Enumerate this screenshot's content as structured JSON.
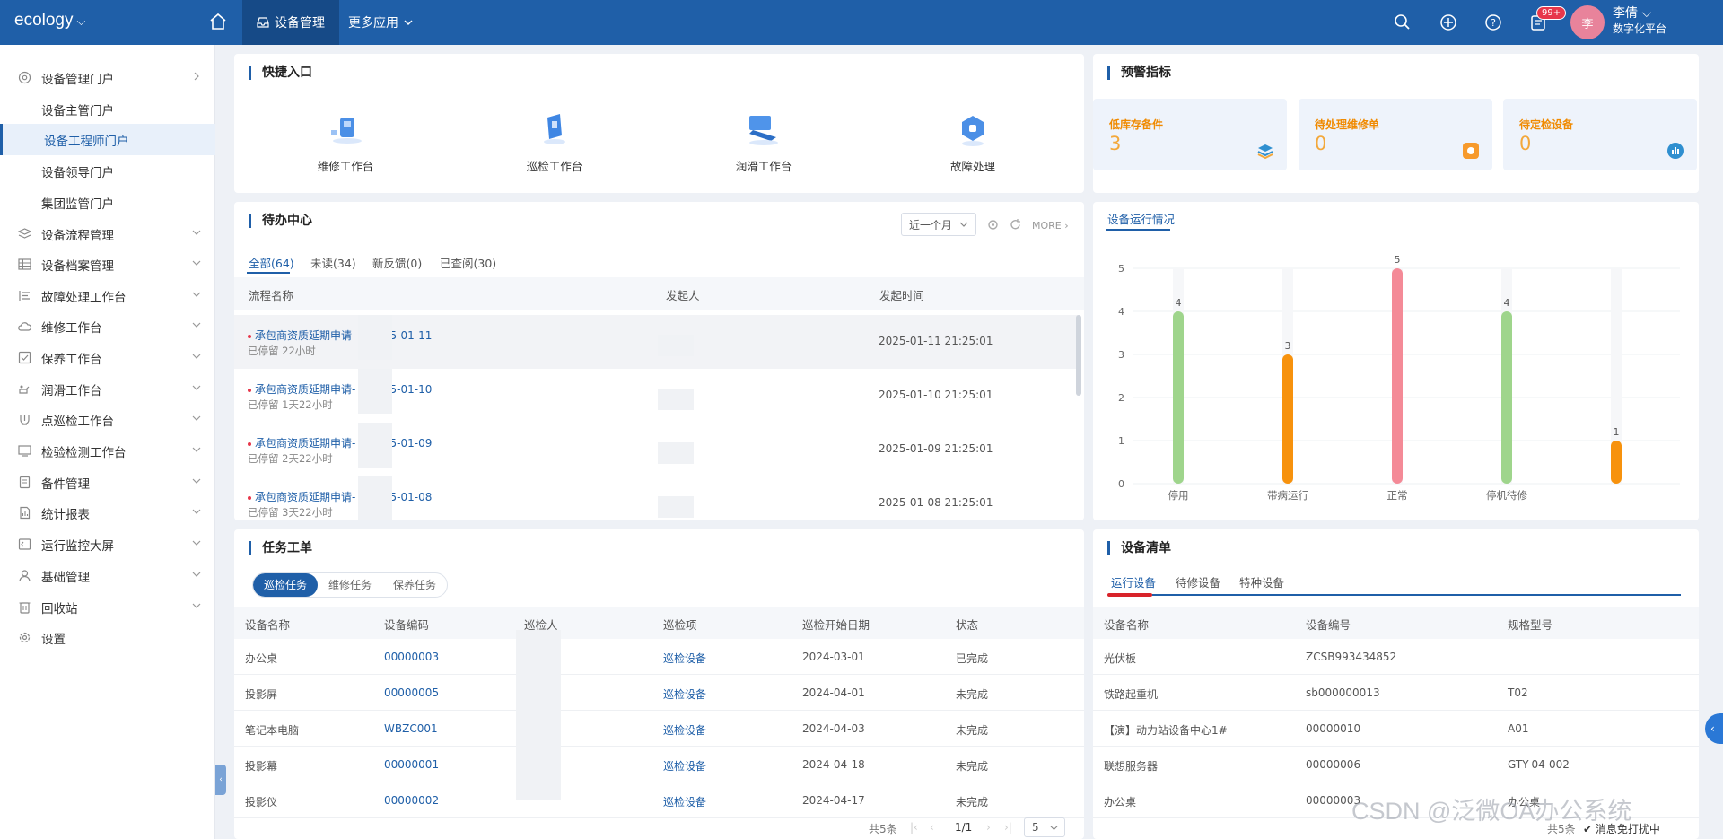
{
  "topbar": {
    "brand": "ecology",
    "nav_active": "设备管理",
    "nav_more": "更多应用",
    "badge": "99+",
    "avatar_text": "李",
    "user_name": "李倩",
    "user_org": "数字化平台"
  },
  "sidebar": {
    "items": [
      {
        "label": "设备管理门户",
        "icon": "at-icon"
      },
      {
        "label": "设备主管门户",
        "icon": ""
      },
      {
        "label": "设备工程师门户",
        "icon": ""
      },
      {
        "label": "设备领导门户",
        "icon": ""
      },
      {
        "label": "集团监管门户",
        "icon": ""
      },
      {
        "label": "设备流程管理",
        "icon": "layers-icon"
      },
      {
        "label": "设备档案管理",
        "icon": "table-icon"
      },
      {
        "label": "故障处理工作台",
        "icon": "list-icon"
      },
      {
        "label": "维修工作台",
        "icon": "cloud-icon"
      },
      {
        "label": "保养工作台",
        "icon": "check-icon"
      },
      {
        "label": "润滑工作台",
        "icon": "oil-icon"
      },
      {
        "label": "点巡检工作台",
        "icon": "tools-icon"
      },
      {
        "label": "检验检测工作台",
        "icon": "monitor-icon"
      },
      {
        "label": "备件管理",
        "icon": "doc-icon"
      },
      {
        "label": "统计报表",
        "icon": "report-icon"
      },
      {
        "label": "运行监控大屏",
        "icon": "screen-icon"
      },
      {
        "label": "基础管理",
        "icon": "user-icon"
      },
      {
        "label": "回收站",
        "icon": "trash-icon"
      },
      {
        "label": "设置",
        "icon": "gear-icon"
      }
    ]
  },
  "quick": {
    "title": "快捷入口",
    "items": [
      "维修工作台",
      "巡检工作台",
      "润滑工作台",
      "故障处理"
    ]
  },
  "warning": {
    "title": "预警指标",
    "items": [
      {
        "label": "低库存备件",
        "value": "3"
      },
      {
        "label": "待处理维修单",
        "value": "0"
      },
      {
        "label": "待定检设备",
        "value": "0"
      }
    ]
  },
  "todo": {
    "title": "待办中心",
    "period": "近一个月",
    "more": "MORE",
    "tabs": [
      "全部(64)",
      "未读(34)",
      "新反馈(0)",
      "已查阅(30)"
    ],
    "headers": [
      "流程名称",
      "发起人",
      "发起时间"
    ],
    "rows": [
      {
        "name_a": "承包商资质延期申请-",
        "name_b": "025-01-11",
        "status": "已停留  22小时",
        "time": "2025-01-11 21:25:01"
      },
      {
        "name_a": "承包商资质延期申请-",
        "name_b": "025-01-10",
        "status": "已停留  1天22小时",
        "time": "2025-01-10 21:25:01"
      },
      {
        "name_a": "承包商资质延期申请-",
        "name_b": "025-01-09",
        "status": "已停留  2天22小时",
        "time": "2025-01-09 21:25:01"
      },
      {
        "name_a": "承包商资质延期申请-",
        "name_b": "025-01-08",
        "status": "已停留  3天22小时",
        "time": "2025-01-08 21:25:01"
      }
    ]
  },
  "chart_panel": {
    "tab": "设备运行情况"
  },
  "chart_data": {
    "type": "bar",
    "categories": [
      "停用",
      "带病运行",
      "正常",
      "停机待修",
      ""
    ],
    "values": [
      4,
      3,
      5,
      4,
      1
    ],
    "colors": [
      "#9fd58c",
      "#f7920d",
      "#f48a97",
      "#9fd58c",
      "#f7920d"
    ],
    "yticks": [
      "0",
      "1",
      "2",
      "3",
      "4",
      "5"
    ],
    "ylim": [
      0,
      5
    ],
    "grid": true
  },
  "tasks": {
    "title": "任务工单",
    "tabs": [
      "巡检任务",
      "维修任务",
      "保养任务"
    ],
    "headers": [
      "设备名称",
      "设备编码",
      "巡检人",
      "巡检项",
      "巡检开始日期",
      "状态"
    ],
    "rows": [
      {
        "name": "办公桌",
        "code": "00000003",
        "item": "巡检设备",
        "date": "2024-03-01",
        "status": "已完成"
      },
      {
        "name": "投影屏",
        "code": "00000005",
        "item": "巡检设备",
        "date": "2024-04-01",
        "status": "未完成"
      },
      {
        "name": "笔记本电脑",
        "code": "WBZC001",
        "item": "巡检设备",
        "date": "2024-04-03",
        "status": "未完成"
      },
      {
        "name": "投影幕",
        "code": "00000001",
        "item": "巡检设备",
        "date": "2024-04-18",
        "status": "未完成"
      },
      {
        "name": "投影仪",
        "code": "00000002",
        "item": "巡检设备",
        "date": "2024-04-17",
        "status": "未完成"
      }
    ],
    "total": "共5条",
    "page": "1/1",
    "page_size": "5"
  },
  "devices": {
    "title": "设备清单",
    "tabs": [
      "运行设备",
      "待修设备",
      "特种设备"
    ],
    "headers": [
      "设备名称",
      "设备编号",
      "规格型号"
    ],
    "rows": [
      {
        "name": "光伏板",
        "code": "ZCSB993434852",
        "model": ""
      },
      {
        "name": "铁路起重机",
        "code": "sb000000013",
        "model": "T02"
      },
      {
        "name": "【演】动力站设备中心1#",
        "code": "00000010",
        "model": "A01"
      },
      {
        "name": "联想服务器",
        "code": "00000006",
        "model": "GTY-04-002"
      },
      {
        "name": "办公桌",
        "code": "00000003",
        "model": "办公桌"
      }
    ],
    "total": "共5条",
    "message": "消息免打扰中"
  },
  "watermark": "CSDN @泛微OA办公系统"
}
